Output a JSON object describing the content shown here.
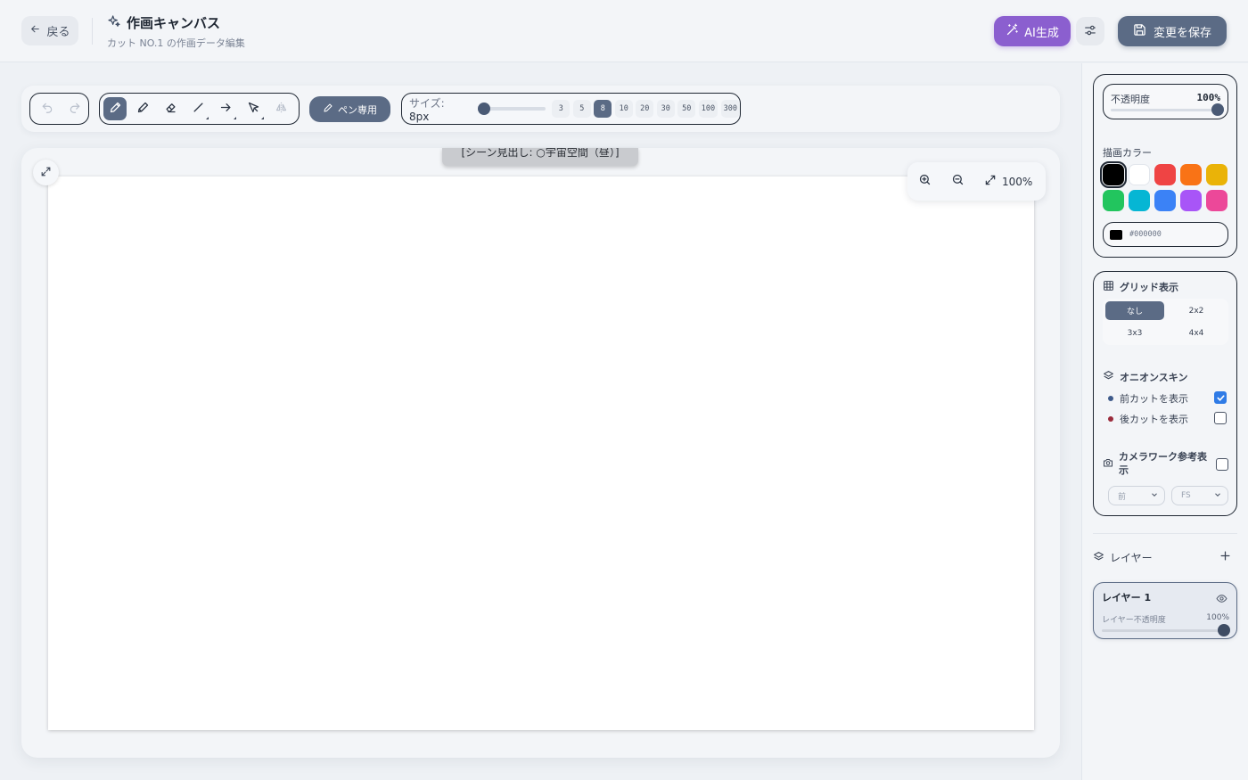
{
  "header": {
    "back_label": "戻る",
    "title": "作画キャンバス",
    "subtitle": "カット NO.1 の作画データ編集",
    "ai_label": "AI生成",
    "save_label": "変更を保存",
    "ai_color": "#8b5fcf",
    "primary_color": "#5b6b85"
  },
  "toolbar": {
    "history_icons": [
      "undo-icon",
      "redo-icon"
    ],
    "tools": [
      {
        "icon": "pen-icon",
        "active": true
      },
      {
        "icon": "pencil-icon",
        "active": false
      },
      {
        "icon": "eraser-icon",
        "active": false
      },
      {
        "icon": "line-icon",
        "active": false
      },
      {
        "icon": "arrow-icon",
        "active": false
      },
      {
        "icon": "select-icon",
        "active": false
      },
      {
        "icon": "mirror-icon",
        "active": false
      }
    ],
    "pen_only_label": "ペン専用",
    "size_prefix": "サイズ:",
    "size_value": "8px",
    "size_options": [
      "3",
      "5",
      "8",
      "10",
      "20",
      "30",
      "50",
      "100",
      "300"
    ],
    "size_selected": "8",
    "size_slider_fraction": 0.02
  },
  "canvas": {
    "scene_label": "[シーン見出し: ○宇宙空間（昼）]",
    "zoom_value": "100%",
    "paper_color": "#ffffff"
  },
  "sidebar": {
    "opacity_label": "不透明度",
    "opacity_value": "100%",
    "opacity_fraction": 1.0,
    "color_label": "描画カラー",
    "swatches": [
      "#000000",
      "#ffffff",
      "#ef4444",
      "#f97316",
      "#eab308",
      "#22c55e",
      "#06b6d4",
      "#3b82f6",
      "#a855f7",
      "#ec4899"
    ],
    "selected_color": "#000000",
    "hex_value": "#000000",
    "grid_label": "グリッド表示",
    "grid_options": [
      "なし",
      "2x2",
      "3x3",
      "4x4"
    ],
    "grid_selected": "なし",
    "onion_label": "オニオンスキン",
    "onion_prev_label": "前カットを表示",
    "onion_prev_checked": true,
    "onion_prev_color": "#3e5a8a",
    "onion_next_label": "後カットを表示",
    "onion_next_checked": false,
    "onion_next_color": "#9b2c3c",
    "camera_label": "カメラワーク参考表示",
    "camera_checked": false,
    "camera_select_1": "前",
    "camera_select_2": "FS",
    "layers_label": "レイヤー",
    "layer_name": "レイヤー 1",
    "layer_opacity_label": "レイヤー不透明度",
    "layer_opacity_value": "100%",
    "layer_opacity_fraction": 1.0
  }
}
